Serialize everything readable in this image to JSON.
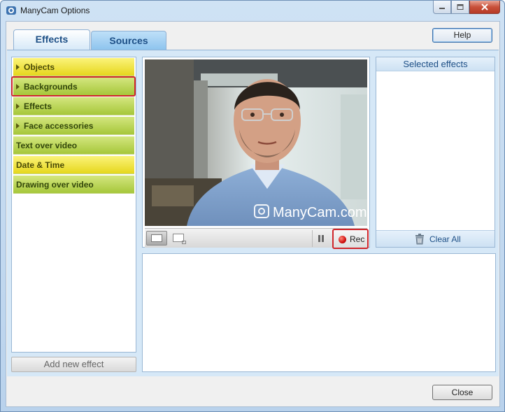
{
  "window": {
    "title": "ManyCam Options",
    "app_icon": "manycam-camera-icon"
  },
  "tabs": [
    {
      "label": "Effects",
      "active": true
    },
    {
      "label": "Sources",
      "active": false
    }
  ],
  "help_label": "Help",
  "effects_list": {
    "items": [
      {
        "label": "Objects",
        "expandable": true,
        "color": "yellow"
      },
      {
        "label": "Backgrounds",
        "expandable": true,
        "color": "green",
        "highlighted": true
      },
      {
        "label": "Effects",
        "expandable": true,
        "color": "green"
      },
      {
        "label": "Face accessories",
        "expandable": true,
        "color": "green"
      },
      {
        "label": "Text over video",
        "expandable": false,
        "color": "green"
      },
      {
        "label": "Date & Time",
        "expandable": false,
        "color": "yellow"
      },
      {
        "label": "Drawing over video",
        "expandable": false,
        "color": "green"
      }
    ],
    "add_button_label": "Add new effect"
  },
  "video": {
    "watermark": "ManyCam.com",
    "rec_label": "Rec"
  },
  "selected_effects": {
    "title": "Selected effects",
    "clear_label": "Clear All"
  },
  "close_label": "Close",
  "colors": {
    "accent": "#1d4f86",
    "highlight_red": "#d0252a",
    "yellow": "#e6d71d",
    "green": "#a6c73a"
  }
}
